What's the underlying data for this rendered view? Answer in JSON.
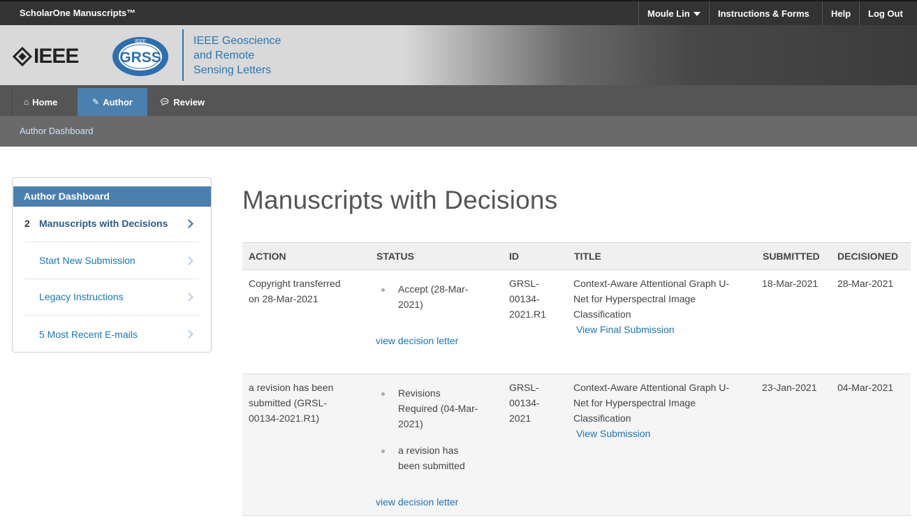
{
  "topbar": {
    "brand": "ScholarOne Manuscripts™",
    "user_menu": "Moule Lin",
    "instructions": "Instructions & Forms",
    "help": "Help",
    "logout": "Log Out"
  },
  "banner": {
    "ieee_logo_text": "IEEE",
    "grss_logo_text": "GRSS",
    "grss_ring_text": "IEEE",
    "journal_line1": "IEEE Geoscience",
    "journal_line2": "and Remote",
    "journal_line3": "Sensing Letters"
  },
  "mainnav": {
    "home": "Home",
    "author": "Author",
    "review": "Review"
  },
  "breadcrumb": "Author Dashboard",
  "sidebar": {
    "header": "Author Dashboard",
    "items": [
      {
        "count": "2",
        "label": "Manuscripts with Decisions"
      },
      {
        "count": "",
        "label": "Start New Submission"
      },
      {
        "count": "",
        "label": "Legacy Instructions"
      },
      {
        "count": "",
        "label": "5 Most Recent E-mails"
      }
    ]
  },
  "content": {
    "title": "Manuscripts with Decisions",
    "columns": [
      "ACTION",
      "STATUS",
      "ID",
      "TITLE",
      "SUBMITTED",
      "DECISIONED"
    ],
    "rows": [
      {
        "action_l1": "Copyright transferred",
        "action_l2": "on 28-Mar-2021",
        "status1_l1": "Accept (28-Mar-",
        "status1_l2": "2021)",
        "decision_link": "view decision letter",
        "id_l1": "GRSL-",
        "id_l2": "00134-",
        "id_l3": "2021.R1",
        "title_l1": "Context-Aware Attentional Graph U-",
        "title_l2": "Net for Hyperspectral Image",
        "title_l3": "Classification",
        "title_link": "View Final Submission",
        "submitted": "18-Mar-2021",
        "decisioned": "28-Mar-2021"
      },
      {
        "action_l1": "a revision has been",
        "action_l2": "submitted (GRSL-",
        "action_l3": "00134-2021.R1)",
        "status1_l1": "Revisions",
        "status1_l2": "Required (04-Mar-",
        "status1_l3": "2021)",
        "status2_l1": "a revision has",
        "status2_l2": "been submitted",
        "decision_link": "view decision letter",
        "id_l1": "GRSL-",
        "id_l2": "00134-",
        "id_l3": "2021",
        "title_l1": "Context-Aware Attentional Graph U-",
        "title_l2": "Net for Hyperspectral Image",
        "title_l3": "Classification",
        "title_link": "View Submission",
        "submitted": "23-Jan-2021",
        "decisioned": "04-Mar-2021"
      }
    ]
  },
  "colors": {
    "accent_blue": "#4a7fae",
    "link_blue": "#1d75b3",
    "topbar_bg": "#333333"
  }
}
